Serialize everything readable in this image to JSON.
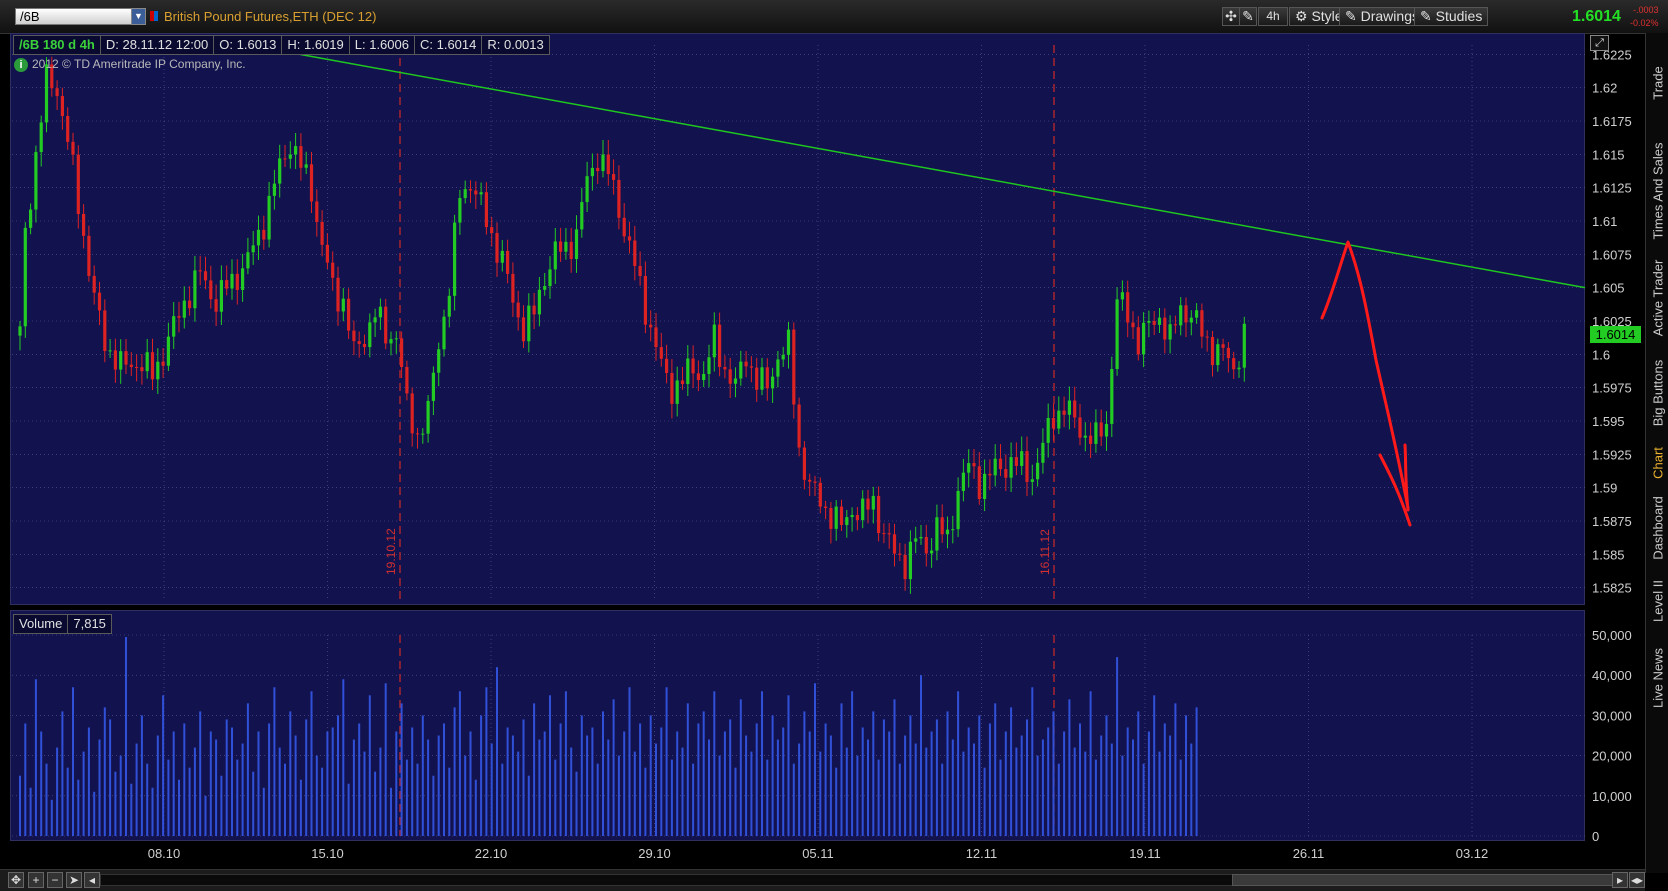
{
  "header": {
    "symbol": "/6B",
    "title": "British Pound Futures,ETH (DEC 12)",
    "aggregation": "4h",
    "style_label": "Style",
    "drawings_label": "Drawings",
    "studies_label": "Studies",
    "last_price": "1.6014",
    "change_abs": "-.0003",
    "change_pct": "-0.02%"
  },
  "info_bar": {
    "symbol_period": "/6B 180 d 4h",
    "date": "D: 28.11.12 12:00",
    "open": "O: 1.6013",
    "high": "H: 1.6019",
    "low": "L: 1.6006",
    "close": "C: 1.6014",
    "range": "R: 0.0013"
  },
  "copyright": "2012 © TD Ameritrade IP Company, Inc.",
  "volume_panel": {
    "label": "Volume",
    "value": "7,815"
  },
  "price_badge": "1.6014",
  "vlines": [
    "19.10.12",
    "16.11.12"
  ],
  "right_tabs": [
    "Trade",
    "Times And Sales",
    "Active Trader",
    "Big Buttons",
    "Chart",
    "Dashboard",
    "Level II",
    "Live News"
  ],
  "active_tab": "Chart",
  "colors": {
    "background": "#12124f",
    "up_candle": "#22cc22",
    "down_candle": "#dd2222",
    "trendline": "#1ec81e",
    "volume": "#3050d8",
    "annotation": "#ff1a1a",
    "grid": "#5a5a9a"
  },
  "chart_data": [
    {
      "type": "candlestick",
      "title": "/6B 180 d 4h",
      "x_ticks": [
        "08.10",
        "15.10",
        "22.10",
        "29.10",
        "05.11",
        "12.11",
        "19.11",
        "26.11",
        "03.12"
      ],
      "y_ticks": [
        "1.6225",
        "1.62",
        "1.6175",
        "1.615",
        "1.6125",
        "1.61",
        "1.6075",
        "1.605",
        "1.6025",
        "1.6",
        "1.5975",
        "1.595",
        "1.5925",
        "1.59",
        "1.5875",
        "1.585",
        "1.5825"
      ],
      "ylim": [
        1.5815,
        1.6232
      ],
      "trendline": {
        "from": [
          "04.10",
          1.6225
        ],
        "to": [
          "04.12",
          1.605
        ]
      },
      "path_points": [
        [
          1,
          1.609
        ],
        [
          3,
          1.615
        ],
        [
          5,
          1.6205
        ],
        [
          7,
          1.62
        ],
        [
          9,
          1.616
        ],
        [
          12,
          1.609
        ],
        [
          14,
          1.604
        ],
        [
          16,
          1.601
        ],
        [
          19,
          1.599
        ],
        [
          22,
          1.5995
        ],
        [
          25,
          1.5985
        ],
        [
          28,
          1.601
        ],
        [
          31,
          1.604
        ],
        [
          34,
          1.606
        ],
        [
          37,
          1.604
        ],
        [
          40,
          1.6055
        ],
        [
          43,
          1.607
        ],
        [
          46,
          1.61
        ],
        [
          49,
          1.614
        ],
        [
          51,
          1.616
        ],
        [
          53,
          1.614
        ],
        [
          55,
          1.6125
        ],
        [
          57,
          1.608
        ],
        [
          59,
          1.605
        ],
        [
          61,
          1.604
        ],
        [
          63,
          1.6
        ],
        [
          65,
          1.6015
        ],
        [
          67,
          1.603
        ],
        [
          69,
          1.6015
        ],
        [
          71,
          1.6015
        ],
        [
          73,
          1.596
        ],
        [
          75,
          1.594
        ],
        [
          77,
          1.5955
        ],
        [
          79,
          1.601
        ],
        [
          81,
          1.605
        ],
        [
          83,
          1.612
        ],
        [
          85,
          1.613
        ],
        [
          87,
          1.611
        ],
        [
          89,
          1.609
        ],
        [
          91,
          1.607
        ],
        [
          93,
          1.604
        ],
        [
          95,
          1.602
        ],
        [
          97,
          1.603
        ],
        [
          99,
          1.606
        ],
        [
          101,
          1.6075
        ],
        [
          103,
          1.608
        ],
        [
          105,
          1.609
        ],
        [
          107,
          1.613
        ],
        [
          109,
          1.615
        ],
        [
          111,
          1.6135
        ],
        [
          113,
          1.611
        ],
        [
          115,
          1.608
        ],
        [
          117,
          1.605
        ],
        [
          119,
          1.602
        ],
        [
          121,
          1.599
        ],
        [
          123,
          1.5975
        ],
        [
          125,
          1.598
        ],
        [
          127,
          1.599
        ],
        [
          129,
          1.5985
        ],
        [
          131,
          1.601
        ],
        [
          133,
          1.599
        ],
        [
          135,
          1.5975
        ],
        [
          137,
          1.6
        ],
        [
          139,
          1.598
        ],
        [
          141,
          1.5975
        ],
        [
          143,
          1.6
        ],
        [
          145,
          1.6005
        ],
        [
          147,
          1.593
        ],
        [
          149,
          1.59
        ],
        [
          151,
          1.589
        ],
        [
          153,
          1.588
        ],
        [
          155,
          1.587
        ],
        [
          157,
          1.5885
        ],
        [
          159,
          1.588
        ],
        [
          161,
          1.589
        ],
        [
          163,
          1.5865
        ],
        [
          165,
          1.585
        ],
        [
          167,
          1.5845
        ],
        [
          169,
          1.586
        ],
        [
          171,
          1.5855
        ],
        [
          173,
          1.587
        ],
        [
          175,
          1.586
        ],
        [
          177,
          1.59
        ],
        [
          179,
          1.5915
        ],
        [
          181,
          1.5905
        ],
        [
          183,
          1.591
        ],
        [
          185,
          1.5915
        ],
        [
          187,
          1.592
        ],
        [
          189,
          1.5915
        ],
        [
          191,
          1.591
        ],
        [
          193,
          1.593
        ],
        [
          195,
          1.5955
        ],
        [
          197,
          1.596
        ],
        [
          199,
          1.595
        ],
        [
          201,
          1.594
        ],
        [
          203,
          1.5935
        ],
        [
          205,
          1.595
        ],
        [
          207,
          1.604
        ],
        [
          209,
          1.603
        ],
        [
          211,
          1.601
        ],
        [
          213,
          1.602
        ],
        [
          215,
          1.603
        ],
        [
          217,
          1.601
        ],
        [
          219,
          1.6035
        ],
        [
          221,
          1.603
        ],
        [
          223,
          1.6015
        ],
        [
          225,
          1.6005
        ],
        [
          227,
          1.6
        ],
        [
          229,
          1.599
        ],
        [
          231,
          1.6014
        ]
      ],
      "annotation": "hand-drawn arrow: rise to trendline then down"
    },
    {
      "type": "bar",
      "title": "Volume",
      "y_ticks": [
        "50,000",
        "40,000",
        "30,000",
        "20,000",
        "10,000",
        "0"
      ],
      "ylim": [
        0,
        50000
      ],
      "values": [
        15000,
        28000,
        12000,
        39000,
        26000,
        18000,
        9000,
        22000,
        31000,
        17000,
        37000,
        14000,
        21000,
        27000,
        11000,
        24000,
        32000,
        29000,
        16000,
        20000,
        49500,
        13000,
        23000,
        30000,
        18000,
        12000,
        25000,
        35000,
        19000,
        26000,
        14000,
        28000,
        17000,
        22000,
        31000,
        10000,
        26000,
        24000,
        15000,
        29000,
        27000,
        19000,
        23000,
        33000,
        16000,
        26000,
        12000,
        28000,
        37000,
        22000,
        18000,
        31000,
        25000,
        14000,
        29000,
        36000,
        20000,
        17000,
        26000,
        27000,
        30000,
        39000,
        13000,
        24000,
        28000,
        21000,
        35000,
        16000,
        22000,
        38000,
        12000,
        26000,
        33000,
        19000,
        27000,
        18000,
        30000,
        24000,
        15000,
        25000,
        28000,
        17000,
        32000,
        36000,
        20000,
        26000,
        14000,
        30000,
        37000,
        23000,
        42000,
        18000,
        27000,
        25000,
        21000,
        29000,
        15000,
        33000,
        24000,
        26000,
        35000,
        19000,
        28000,
        36000,
        22000,
        16000,
        30000,
        25000,
        27000,
        18000,
        31000,
        24000,
        34000,
        20000,
        26000,
        37000,
        21000,
        28000,
        17000,
        30000,
        23000,
        27000,
        37000,
        19000,
        26000,
        22000,
        33000,
        18000,
        28000,
        31000,
        24000,
        36000,
        20000,
        26000,
        29000,
        17000,
        34000,
        25000,
        21000,
        28000,
        36000,
        19000,
        30000,
        24000,
        27000,
        35000,
        18000,
        23000,
        31000,
        26000,
        38000,
        21000,
        28000,
        25000,
        17000,
        33000,
        22000,
        36000,
        20000,
        27000,
        24000,
        31000,
        19000,
        29000,
        26000,
        34000,
        18000,
        25000,
        30000,
        23000,
        40000,
        22000,
        26000,
        29000,
        18000,
        31000,
        24000,
        36000,
        21000,
        27000,
        23000,
        30000,
        17000,
        28000,
        33000,
        19000,
        26000,
        32000,
        22000,
        25000,
        29000,
        37000,
        20000,
        24000,
        27000,
        31000,
        18000,
        26000,
        34000,
        22000,
        28000,
        21000,
        36000,
        19000,
        25000,
        30000,
        23000,
        44500,
        20000,
        27000,
        24000,
        31000,
        18000,
        26000,
        35000,
        21000,
        28000,
        25000,
        33000,
        19000,
        30000,
        23000,
        32000
      ]
    }
  ]
}
